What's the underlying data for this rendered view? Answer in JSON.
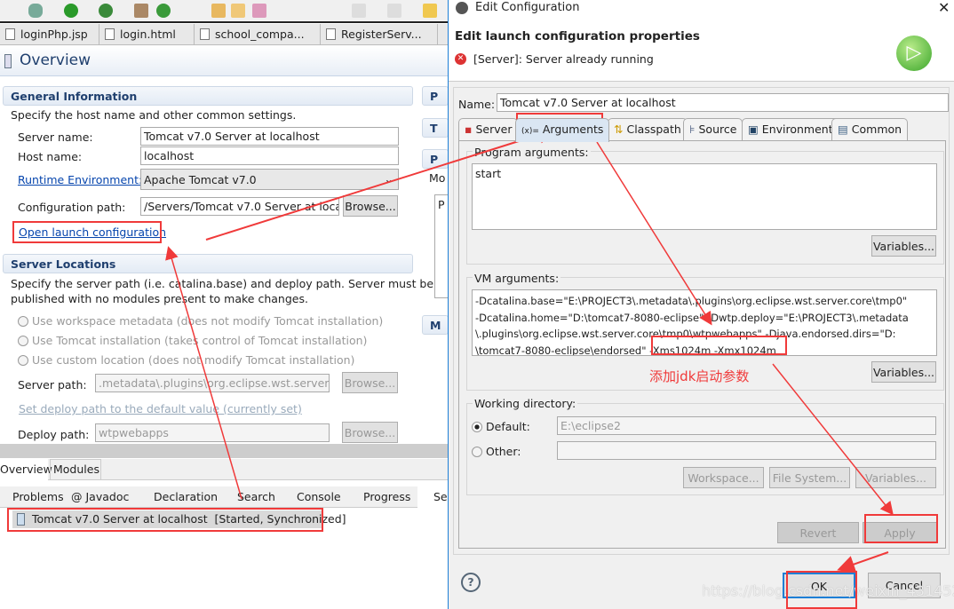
{
  "toolbar": {
    "icons": [
      "debug-icon",
      "run-icon",
      "run-server-icon",
      "new-package-icon",
      "refresh-icon",
      "open-folder-icon",
      "folder-icon",
      "search-tool-icon",
      "next-annotation-icon",
      "prev-annotation-icon",
      "back-icon"
    ]
  },
  "editor_tabs": [
    "loginPhp.jsp",
    "login.html",
    "school_compa...",
    "RegisterServ..."
  ],
  "overview": {
    "title": "Overview",
    "general": {
      "title": "General Information",
      "desc": "Specify the host name and other common settings.",
      "server_name_label": "Server name:",
      "server_name": "Tomcat v7.0 Server at localhost",
      "host_name_label": "Host name:",
      "host_name": "localhost",
      "runtime_label": "Runtime Environment:",
      "runtime": "Apache Tomcat v7.0",
      "config_path_label": "Configuration path:",
      "config_path": "/Servers/Tomcat v7.0 Server at localho",
      "browse": "Browse...",
      "open_launch": "Open launch configuration"
    },
    "locations": {
      "title": "Server Locations",
      "desc1": "Specify the server path (i.e. catalina.base) and deploy path. Server must be",
      "desc2": "published with no modules present to make changes.",
      "opt1": "Use workspace metadata (does not modify Tomcat installation)",
      "opt2": "Use Tomcat installation (takes control of Tomcat installation)",
      "opt3": "Use custom location (does not modify Tomcat installation)",
      "server_path_label": "Server path:",
      "server_path": ".metadata\\.plugins\\org.eclipse.wst.server.cor",
      "browse": "Browse...",
      "set_default": "Set deploy path to the default value (currently set)",
      "deploy_label": "Deploy path:",
      "deploy": "wtpwebapps"
    },
    "right_sections": [
      "P",
      "T",
      "P",
      "M"
    ],
    "right_mo": "Mo",
    "right_pc": "P",
    "bottom_tabs": [
      "Overview",
      "Modules"
    ]
  },
  "views": {
    "tabs": [
      "Problems",
      "Javadoc",
      "Declaration",
      "Search",
      "Console",
      "Progress",
      "Se"
    ],
    "server_row": "Tomcat v7.0 Server at localhost  [Started, Synchronized]"
  },
  "dialog": {
    "title": "Edit Configuration",
    "heading": "Edit launch configuration properties",
    "error": "[Server]: Server already running",
    "name_label": "Name:",
    "name": "Tomcat v7.0 Server at localhost",
    "tabs": [
      "Server",
      "Arguments",
      "Classpath",
      "Source",
      "Environment",
      "Common"
    ],
    "active_tab": "Arguments",
    "program_args_label": "Program arguments:",
    "program_args": "start",
    "variables": "Variables...",
    "vm_args_label": "VM arguments:",
    "vm_lines": [
      "-Dcatalina.base=\"E:\\PROJECT3\\.metadata\\.plugins\\org.eclipse.wst.server.core\\tmp0\"",
      "-Dcatalina.home=\"D:\\tomcat7-8080-eclipse\" -Dwtp.deploy=\"E:\\PROJECT3\\.metadata",
      "\\.plugins\\org.eclipse.wst.server.core\\tmp0\\wtpwebapps\" -Djava.endorsed.dirs=\"D:",
      "\\tomcat7-8080-eclipse\\endorsed\" "
    ],
    "vm_added": "-Xms1024m -Xmx1024m",
    "annotation": "添加jdk启动参数",
    "workdir_label": "Working directory:",
    "default_label": "Default:",
    "default_value": "E:\\eclipse2",
    "other_label": "Other:",
    "workspace": "Workspace...",
    "filesystem": "File System...",
    "variables2": "Variables...",
    "revert": "Revert",
    "apply": "Apply",
    "ok": "OK",
    "cancel": "Cancel"
  },
  "watermark": "https://blog.csdn.net/weixin_43145299",
  "colors": {
    "annotation_red": "#f03a3a",
    "link": "#0645ad",
    "section_title": "#1f3f6e"
  }
}
